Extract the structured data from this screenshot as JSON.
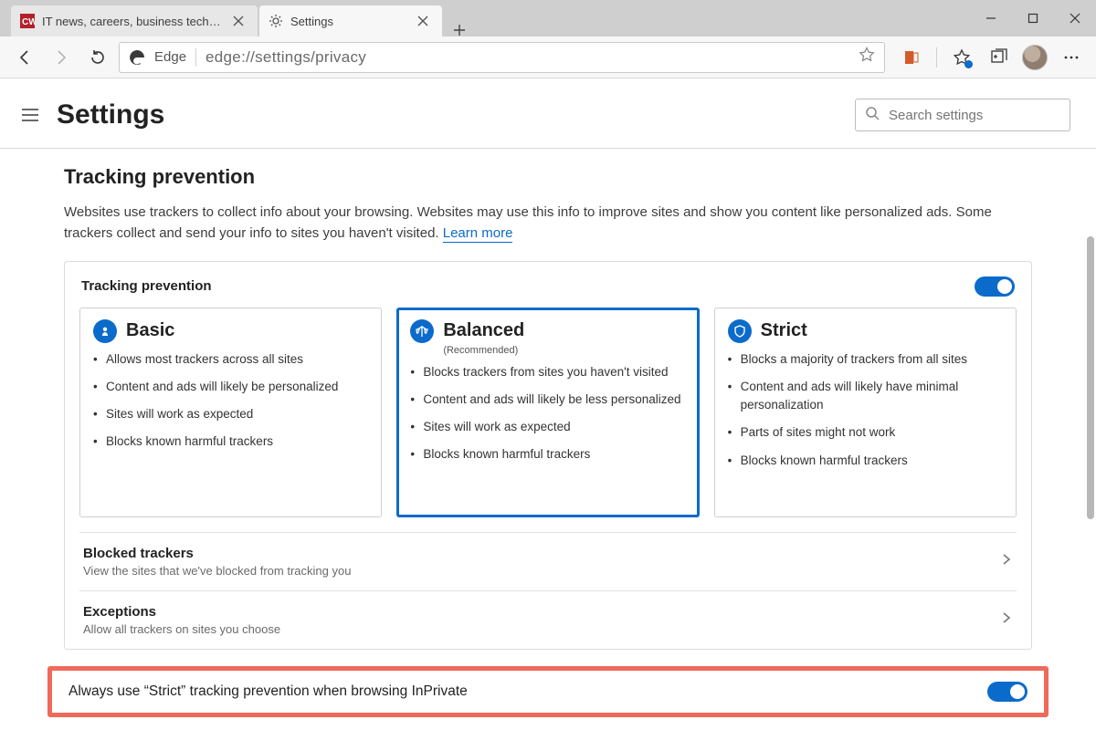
{
  "window": {
    "tabs": [
      {
        "title": "IT news, careers, business technology",
        "active": false
      },
      {
        "title": "Settings",
        "active": true
      }
    ]
  },
  "toolbar": {
    "brand": "Edge",
    "url": "edge://settings/privacy"
  },
  "header": {
    "title": "Settings",
    "search_placeholder": "Search settings"
  },
  "tracking": {
    "title": "Tracking prevention",
    "desc_a": "Websites use trackers to collect info about your browsing. Websites may use this info to improve sites and show you content like personalized ads. Some trackers collect and send your info to sites you haven't visited. ",
    "learn_more": "Learn more",
    "card_label": "Tracking prevention",
    "toggle_on": true,
    "levels": [
      {
        "key": "basic",
        "title": "Basic",
        "subtitle": "",
        "bullets": [
          "Allows most trackers across all sites",
          "Content and ads will likely be personalized",
          "Sites will work as expected",
          "Blocks known harmful trackers"
        ],
        "selected": false
      },
      {
        "key": "balanced",
        "title": "Balanced",
        "subtitle": "(Recommended)",
        "bullets": [
          "Blocks trackers from sites you haven't visited",
          "Content and ads will likely be less personalized",
          "Sites will work as expected",
          "Blocks known harmful trackers"
        ],
        "selected": true
      },
      {
        "key": "strict",
        "title": "Strict",
        "subtitle": "",
        "bullets": [
          "Blocks a majority of trackers from all sites",
          "Content and ads will likely have minimal personalization",
          "Parts of sites might not work",
          "Blocks known harmful trackers"
        ],
        "selected": false
      }
    ],
    "rows": [
      {
        "title": "Blocked trackers",
        "desc": "View the sites that we've blocked from tracking you"
      },
      {
        "title": "Exceptions",
        "desc": "Allow all trackers on sites you choose"
      }
    ],
    "strict_inprivate": "Always use “Strict” tracking prevention when browsing InPrivate"
  },
  "colors": {
    "accent": "#0b6bcb",
    "highlight": "#ef6a5a"
  }
}
